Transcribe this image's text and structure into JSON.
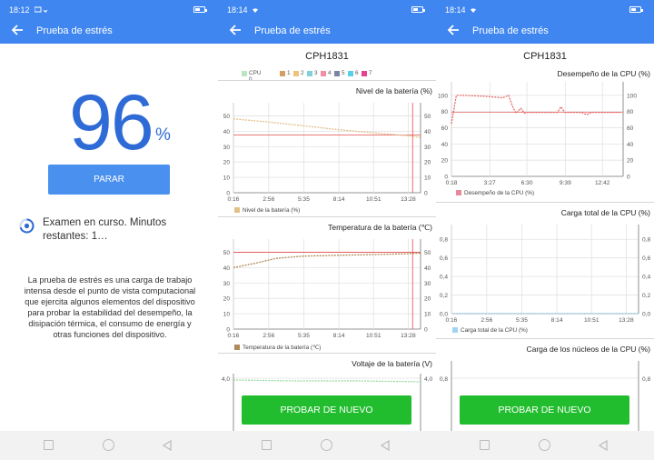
{
  "screens": [
    {
      "status": {
        "time": "18:12"
      },
      "appbar": {
        "title": "Prueba de estrés"
      },
      "progress": {
        "value": "96",
        "unit": "%"
      },
      "stop_label": "PARAR",
      "exam_status": "Examen en curso. Minutos restantes: 1…",
      "description": "La prueba de estrés es una carga de trabajo intensa desde el punto de vista computacional que ejercita algunos elementos del dispositivo para probar la estabilidad del desempeño, la disipación térmica, el consumo de energía y otras funciones del dispositivo."
    },
    {
      "status": {
        "time": "18:14"
      },
      "appbar": {
        "title": "Prueba de estrés"
      },
      "device": "CPH1831",
      "cpu_legend": [
        "CPU 0",
        "1",
        "2",
        "3",
        "4",
        "5",
        "6",
        "7"
      ],
      "retry_label": "PROBAR DE NUEVO"
    },
    {
      "status": {
        "time": "18:14"
      },
      "appbar": {
        "title": "Prueba de estrés"
      },
      "device": "CPH1831",
      "retry_label": "PROBAR DE NUEVO"
    }
  ],
  "colors": {
    "accent": "#3f86f0",
    "green": "#22bd2e",
    "cpu_legend": [
      "#b6e7c0",
      "#d2a060",
      "#f0c27a",
      "#7fd2d8",
      "#ef8fa8",
      "#7c83a4",
      "#58d0e8",
      "#ea4090"
    ]
  },
  "icons": [
    "back-arrow-icon",
    "wifi-icon",
    "battery-icon",
    "progress-ring-icon",
    "square-nav-icon",
    "circle-nav-icon",
    "triangle-nav-icon"
  ],
  "chart_data": [
    {
      "type": "line",
      "title": "Nivel de la batería (%)",
      "x_ticks": [
        "0:16",
        "2:56",
        "5:35",
        "8:14",
        "10:51",
        "13:28"
      ],
      "y_ticks": [
        "0",
        "10",
        "20",
        "30",
        "40",
        "50"
      ],
      "ylim": [
        0,
        55
      ],
      "series": [
        {
          "name": "Nivel de la batería (%)",
          "color": "#e3c08a",
          "x": [
            0.27,
            2.93,
            5.58,
            8.23,
            10.85,
            13.47,
            14.4
          ],
          "values": [
            48,
            46,
            43.5,
            41,
            39,
            37,
            36
          ]
        }
      ],
      "marker_line": {
        "x": 13.8,
        "color": "#e64a4a"
      },
      "reference_line": {
        "y": 37.5,
        "color": "#e64a4a"
      }
    },
    {
      "type": "line",
      "title": "Temperatura de la batería (℃)",
      "x_ticks": [
        "0:16",
        "2:56",
        "5:35",
        "8:14",
        "10:51",
        "13:28"
      ],
      "y_ticks": [
        "0",
        "10",
        "20",
        "30",
        "40",
        "50"
      ],
      "ylim": [
        0,
        55
      ],
      "series": [
        {
          "name": "Temperatura de la batería (℃)",
          "color": "#b08a58",
          "x": [
            0.27,
            2.0,
            3.5,
            5.58,
            8.23,
            10.85,
            13.47,
            14.4
          ],
          "values": [
            40,
            43,
            46,
            47.5,
            48,
            48.5,
            49,
            49.5
          ]
        }
      ],
      "marker_line": {
        "x": 13.8,
        "color": "#e64a4a"
      },
      "reference_line": {
        "y": 50,
        "color": "#e64a4a"
      }
    },
    {
      "type": "line",
      "title": "Voltaje de la batería (V)",
      "y_ticks": [
        "4,0"
      ],
      "series": [
        {
          "name": "Voltaje de la batería (V)",
          "color": "#8fd89f",
          "values": [
            3.98,
            3.97,
            3.97,
            3.96
          ]
        }
      ]
    },
    {
      "type": "line",
      "title": "Desempeño de la CPU (%)",
      "x_ticks": [
        "0:18",
        "3:27",
        "6:30",
        "9:39",
        "12:42"
      ],
      "y_ticks": [
        "0",
        "20",
        "40",
        "60",
        "80",
        "100"
      ],
      "ylim": [
        0,
        110
      ],
      "series": [
        {
          "name": "Desempeño de la CPU (%)",
          "color": "#e86a6a",
          "x": [
            0.3,
            0.7,
            1.2,
            3.0,
            4.5,
            5.0,
            5.3,
            5.6,
            6.0,
            6.3,
            6.5,
            7.0,
            9.0,
            9.3,
            9.6,
            10.0,
            11.0,
            11.4,
            11.8,
            13.0,
            14.2
          ],
          "values": [
            65,
            100,
            100,
            99,
            97,
            100,
            87,
            78,
            84,
            78,
            79,
            79,
            79,
            86,
            79,
            79,
            79,
            76,
            79,
            79,
            79
          ]
        }
      ],
      "reference_line": {
        "y": 79,
        "color": "#e86a6a"
      }
    },
    {
      "type": "line",
      "title": "Carga total de la CPU (%)",
      "x_ticks": [
        "0:16",
        "2:56",
        "5:35",
        "8:14",
        "10:51",
        "13:28"
      ],
      "y_ticks": [
        "0,0",
        "0,2",
        "0,4",
        "0,6",
        "0,8"
      ],
      "ylim": [
        0,
        0.9
      ],
      "series": [
        {
          "name": "Carga total de la CPU (%)",
          "color": "#9fd4f2",
          "x": [
            0.27,
            14.4
          ],
          "values": [
            0,
            0
          ]
        }
      ]
    },
    {
      "type": "line",
      "title": "Carga de los núcleos de la CPU (%)",
      "y_ticks": [
        "0,8"
      ]
    }
  ]
}
